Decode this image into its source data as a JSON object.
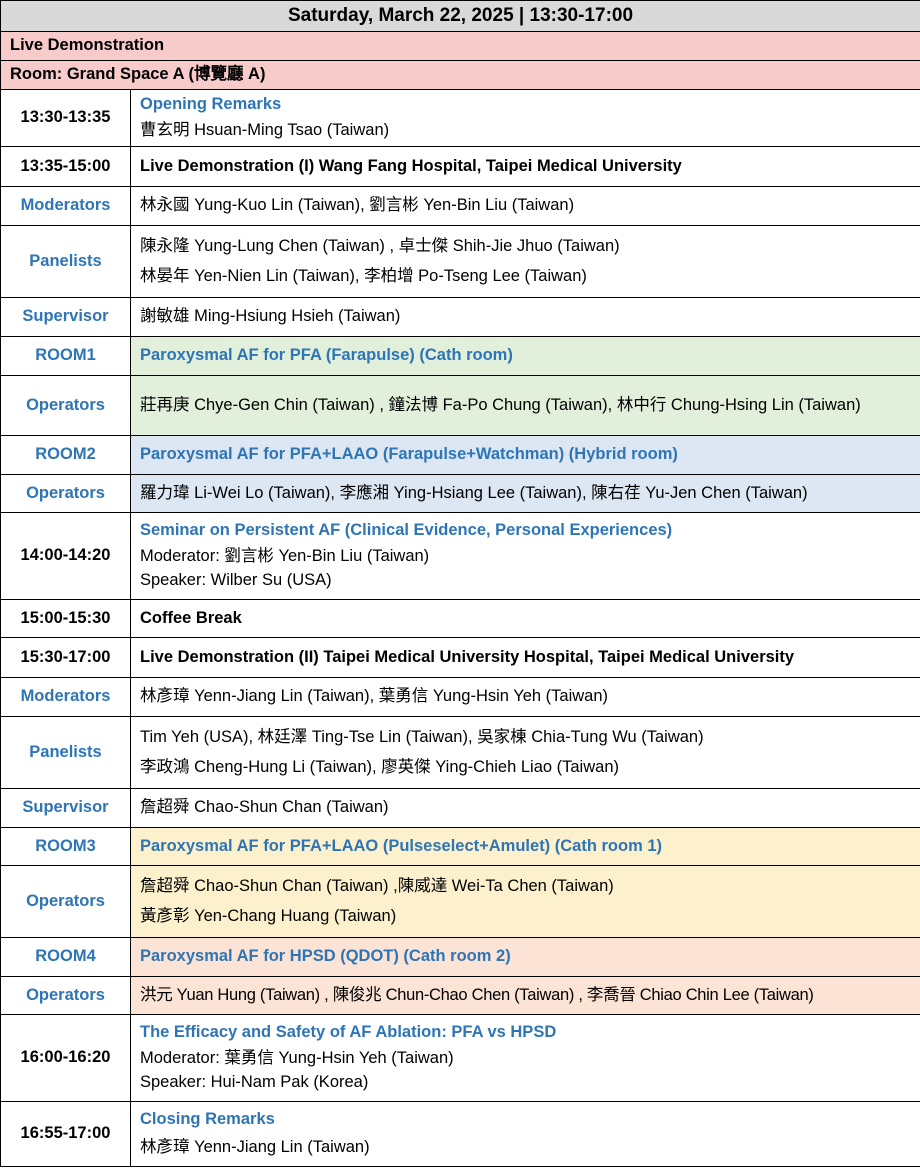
{
  "header": "Saturday, March 22, 2025 | 13:30-17:00",
  "session": {
    "title": "Live Demonstration",
    "room": "Room: Grand Space A (博覽廳 A)"
  },
  "rows": {
    "opening": {
      "time": "13:30-13:35",
      "title": "Opening Remarks",
      "line1": "曹玄明 Hsuan-Ming Tsao (Taiwan)"
    },
    "live1": {
      "time": "13:35-15:00",
      "title": "Live Demonstration (I) Wang Fang Hospital, Taipei Medical University",
      "moderators_label": "Moderators",
      "moderators": "林永國 Yung-Kuo Lin (Taiwan), 劉言彬 Yen-Bin Liu (Taiwan)",
      "panelists_label": "Panelists",
      "panelists_1": "陳永隆 Yung-Lung Chen (Taiwan) , 卓士傑 Shih-Jie Jhuo (Taiwan)",
      "panelists_2": "林晏年 Yen-Nien Lin (Taiwan), 李柏增 Po-Tseng Lee (Taiwan)",
      "supervisor_label": "Supervisor",
      "supervisor": "謝敏雄 Ming-Hsiung Hsieh (Taiwan)",
      "room1_label": "ROOM1",
      "room1": "Paroxysmal AF for PFA (Farapulse) (Cath room)",
      "room1_ops_label": "Operators",
      "room1_ops": "莊再庚 Chye-Gen Chin (Taiwan) , 鐘法博 Fa-Po Chung (Taiwan), 林中行 Chung-Hsing Lin (Taiwan)",
      "room2_label": "ROOM2",
      "room2": "Paroxysmal AF for PFA+LAAO (Farapulse+Watchman) (Hybrid room)",
      "room2_ops_label": "Operators",
      "room2_ops": "羅力瑋 Li-Wei Lo (Taiwan), 李應湘 Ying-Hsiang Lee (Taiwan), 陳右荏 Yu-Jen Chen (Taiwan)"
    },
    "seminar": {
      "time": "14:00-14:20",
      "title": "Seminar on Persistent AF (Clinical Evidence, Personal Experiences)",
      "moderator": "Moderator: 劉言彬 Yen-Bin Liu (Taiwan)",
      "speaker": "Speaker: Wilber Su (USA)"
    },
    "coffee": {
      "time": "15:00-15:30",
      "title": "Coffee Break"
    },
    "live2": {
      "time": "15:30-17:00",
      "title": "Live Demonstration (II) Taipei Medical University Hospital, Taipei Medical University",
      "moderators_label": "Moderators",
      "moderators": "林彥璋 Yenn-Jiang Lin (Taiwan), 葉勇信 Yung-Hsin Yeh (Taiwan)",
      "panelists_label": "Panelists",
      "panelists_1": "Tim Yeh (USA), 林廷澤 Ting-Tse Lin (Taiwan), 吳家棟 Chia-Tung Wu (Taiwan)",
      "panelists_2": "李政鴻 Cheng-Hung Li (Taiwan), 廖英傑 Ying-Chieh Liao (Taiwan)",
      "supervisor_label": "Supervisor",
      "supervisor": "詹超舜 Chao-Shun Chan (Taiwan)",
      "room3_label": "ROOM3",
      "room3": "Paroxysmal AF for PFA+LAAO (Pulseselect+Amulet) (Cath room 1)",
      "room3_ops_label": "Operators",
      "room3_ops_1": "詹超舜 Chao-Shun Chan (Taiwan) ,陳威達 Wei-Ta Chen (Taiwan)",
      "room3_ops_2": "黃彥彰 Yen-Chang Huang (Taiwan)",
      "room4_label": "ROOM4",
      "room4": "Paroxysmal AF for HPSD (QDOT) (Cath room 2)",
      "room4_ops_label": "Operators",
      "room4_ops": "洪元 Yuan Hung (Taiwan) , 陳俊兆 Chun-Chao Chen (Taiwan) , 李喬晉 Chiao Chin Lee (Taiwan)"
    },
    "efficacy": {
      "time": "16:00-16:20",
      "title": "The Efficacy and Safety of AF Ablation: PFA vs HPSD",
      "moderator": "Moderator: 葉勇信 Yung-Hsin Yeh (Taiwan)",
      "speaker": "Speaker: Hui-Nam Pak (Korea)"
    },
    "closing": {
      "time": "16:55-17:00",
      "title": "Closing Remarks",
      "line1": "林彥璋 Yenn-Jiang Lin (Taiwan)"
    }
  }
}
